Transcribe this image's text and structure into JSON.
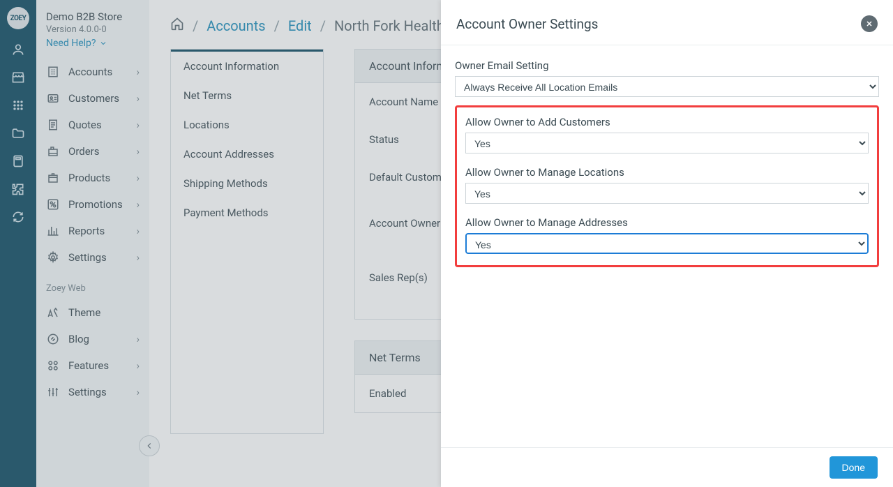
{
  "rail": {
    "logo": "ZOEY"
  },
  "sidebar": {
    "store_title": "Demo B2B Store",
    "version": "Version 4.0.0-0",
    "need_help": "Need Help?",
    "items": [
      {
        "label": "Accounts"
      },
      {
        "label": "Customers"
      },
      {
        "label": "Quotes"
      },
      {
        "label": "Orders"
      },
      {
        "label": "Products"
      },
      {
        "label": "Promotions"
      },
      {
        "label": "Reports"
      },
      {
        "label": "Settings"
      }
    ],
    "web_section": "Zoey Web",
    "web_items": [
      {
        "label": "Theme"
      },
      {
        "label": "Blog"
      },
      {
        "label": "Features"
      },
      {
        "label": "Settings"
      }
    ]
  },
  "breadcrumbs": {
    "accounts": "Accounts",
    "edit": "Edit",
    "current": "North Fork Health Grou"
  },
  "sub_tabs": [
    "Account Information",
    "Net Terms",
    "Locations",
    "Account Addresses",
    "Shipping Methods",
    "Payment Methods"
  ],
  "panel1": {
    "title": "Account Informat",
    "rows": [
      "Account Name",
      "Status",
      "Default Custom",
      "Account Owner",
      "Sales Rep(s)"
    ]
  },
  "panel2": {
    "title": "Net Terms",
    "rows": [
      "Enabled"
    ]
  },
  "modal": {
    "title": "Account Owner Settings",
    "fields": {
      "email_label": "Owner Email Setting",
      "email_value": "Always Receive All Location Emails",
      "add_customers_label": "Allow Owner to Add Customers",
      "add_customers_value": "Yes",
      "manage_locations_label": "Allow Owner to Manage Locations",
      "manage_locations_value": "Yes",
      "manage_addresses_label": "Allow Owner to Manage Addresses",
      "manage_addresses_value": "Yes"
    },
    "done": "Done"
  }
}
